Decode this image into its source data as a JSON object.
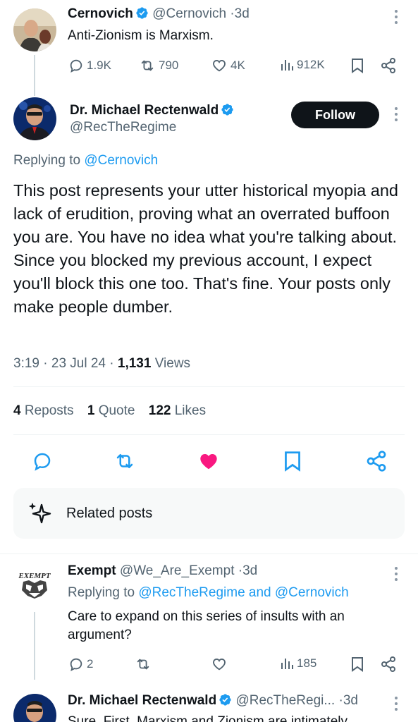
{
  "tweet1": {
    "name": "Cernovich",
    "handle": "@Cernovich",
    "dot": "·",
    "time": "3d",
    "text": "Anti-Zionism is Marxism.",
    "replies": "1.9K",
    "reposts": "790",
    "likes": "4K",
    "views": "912K"
  },
  "main": {
    "name": "Dr. Michael Rectenwald",
    "handle": "@RecTheRegime",
    "follow_label": "Follow",
    "replying_prefix": "Replying to",
    "replying_to": "@Cernovich",
    "text": "This post represents your utter historical myopia and lack of erudition, proving what an overrated buffoon you are. You have no idea what you're talking about. Since you blocked my previous account, I expect you'll block this one too. That's fine. Your posts only make people dumber.",
    "time": "3:19",
    "date": "23 Jul 24",
    "dot1": "·",
    "dot2": "·",
    "views_count": "1,131",
    "views_label": "Views",
    "reposts_count": "4",
    "reposts_label": "Reposts",
    "quotes_count": "1",
    "quotes_label": "Quote",
    "likes_count": "122",
    "likes_label": "Likes"
  },
  "related": {
    "label": "Related posts"
  },
  "reply1": {
    "name": "Exempt",
    "handle": "@We_Are_Exempt",
    "dot": "·",
    "time": "3d",
    "avatar_text": "EXEMPT",
    "replying_prefix": "Replying to",
    "replying_to": "@RecTheRegime and @Cernovich",
    "text": "Care to expand on this series of insults with an argument?",
    "replies": "2",
    "views": "185"
  },
  "reply2": {
    "name": "Dr. Michael Rectenwald",
    "handle": "@RecTheRegi...",
    "dot": "·",
    "time": "3d",
    "text": "Sure. First, Marxism and Zionism are intimately"
  },
  "colors": {
    "accent": "#1d9bf0",
    "like_pink": "#f91880",
    "muted": "#536471"
  }
}
